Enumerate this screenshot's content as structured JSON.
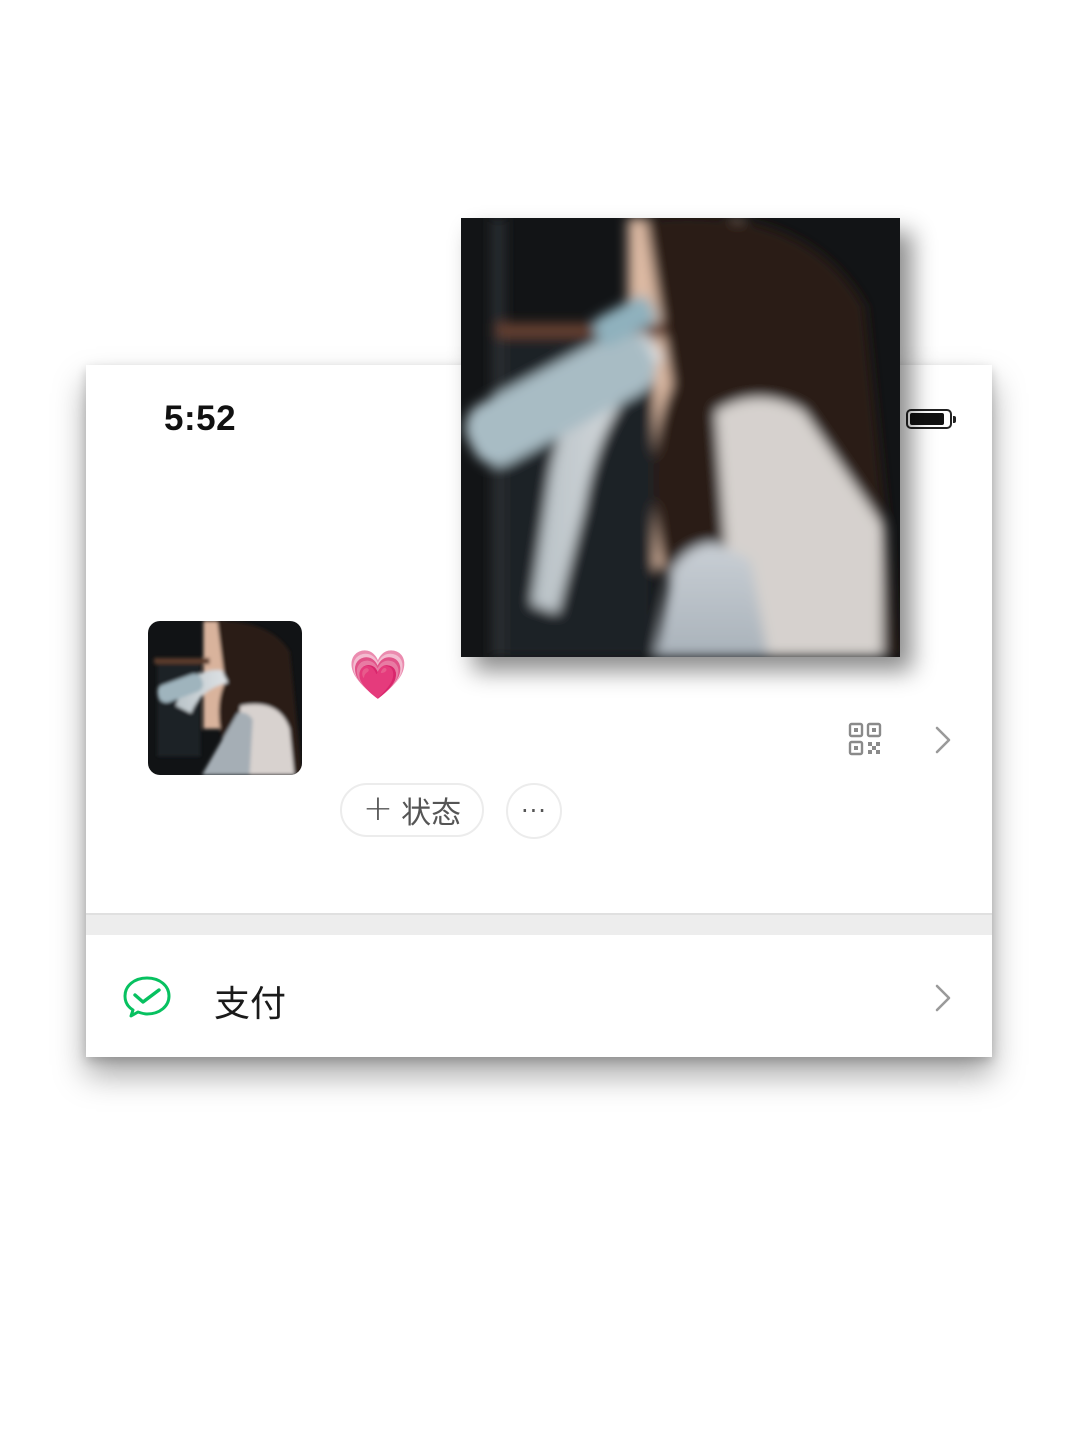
{
  "status_bar": {
    "time": "5:52"
  },
  "profile": {
    "nickname_emoji": "💗",
    "avatar_icon": "avatar-photo",
    "qr_icon": "qr-code-icon",
    "status_button_plus": "+",
    "status_button_label": "状态",
    "more_button_label": "···"
  },
  "menu": {
    "pay_label": "支付",
    "pay_icon": "wechat-pay-icon",
    "pay_icon_color": "#07c160"
  }
}
